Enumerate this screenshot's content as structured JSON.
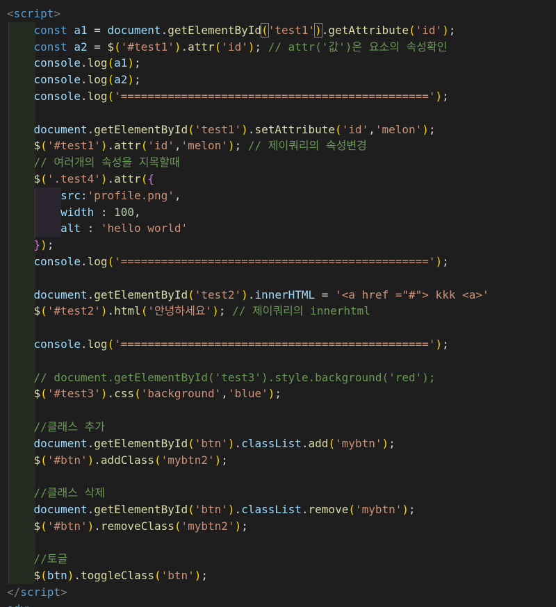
{
  "editor": {
    "lines": [
      [
        {
          "t": "<",
          "c": "tok-bracket"
        },
        {
          "t": "script",
          "c": "tok-tag"
        },
        {
          "t": ">",
          "c": "tok-bracket"
        }
      ],
      [
        {
          "t": "    const ",
          "c": "tok-kw"
        },
        {
          "t": "a1",
          "c": "tok-var"
        },
        {
          "t": " = ",
          "c": "tok-p"
        },
        {
          "t": "document",
          "c": "tok-var"
        },
        {
          "t": ".",
          "c": "tok-p"
        },
        {
          "t": "getElementById",
          "c": "tok-fn"
        },
        {
          "t": "(",
          "c": "tok-brk1 cursor-box"
        },
        {
          "t": "'test1'",
          "c": "tok-str"
        },
        {
          "t": ")",
          "c": "tok-brk1 cursor-box"
        },
        {
          "t": ".",
          "c": "tok-p"
        },
        {
          "t": "getAttribute",
          "c": "tok-fn"
        },
        {
          "t": "(",
          "c": "tok-brk1"
        },
        {
          "t": "'id'",
          "c": "tok-str"
        },
        {
          "t": ")",
          "c": "tok-brk1"
        },
        {
          "t": ";",
          "c": "tok-p"
        }
      ],
      [
        {
          "t": "    const ",
          "c": "tok-kw"
        },
        {
          "t": "a2",
          "c": "tok-var"
        },
        {
          "t": " = ",
          "c": "tok-p"
        },
        {
          "t": "$",
          "c": "tok-fn"
        },
        {
          "t": "(",
          "c": "tok-brk1"
        },
        {
          "t": "'#test1'",
          "c": "tok-str"
        },
        {
          "t": ")",
          "c": "tok-brk1"
        },
        {
          "t": ".",
          "c": "tok-p"
        },
        {
          "t": "attr",
          "c": "tok-fn"
        },
        {
          "t": "(",
          "c": "tok-brk1"
        },
        {
          "t": "'id'",
          "c": "tok-str"
        },
        {
          "t": ")",
          "c": "tok-brk1"
        },
        {
          "t": "; ",
          "c": "tok-p"
        },
        {
          "t": "// attr('값')은 요소의 속성확인",
          "c": "tok-com"
        }
      ],
      [
        {
          "t": "    console",
          "c": "tok-var"
        },
        {
          "t": ".",
          "c": "tok-p"
        },
        {
          "t": "log",
          "c": "tok-fn"
        },
        {
          "t": "(",
          "c": "tok-brk1"
        },
        {
          "t": "a1",
          "c": "tok-var"
        },
        {
          "t": ")",
          "c": "tok-brk1"
        },
        {
          "t": ";",
          "c": "tok-p"
        }
      ],
      [
        {
          "t": "    console",
          "c": "tok-var"
        },
        {
          "t": ".",
          "c": "tok-p"
        },
        {
          "t": "log",
          "c": "tok-fn"
        },
        {
          "t": "(",
          "c": "tok-brk1"
        },
        {
          "t": "a2",
          "c": "tok-var"
        },
        {
          "t": ")",
          "c": "tok-brk1"
        },
        {
          "t": ";",
          "c": "tok-p"
        }
      ],
      [
        {
          "t": "    console",
          "c": "tok-var"
        },
        {
          "t": ".",
          "c": "tok-p"
        },
        {
          "t": "log",
          "c": "tok-fn"
        },
        {
          "t": "(",
          "c": "tok-brk1"
        },
        {
          "t": "'=============================================='",
          "c": "tok-str"
        },
        {
          "t": ")",
          "c": "tok-brk1"
        },
        {
          "t": ";",
          "c": "tok-p"
        }
      ],
      [],
      [
        {
          "t": "    document",
          "c": "tok-var"
        },
        {
          "t": ".",
          "c": "tok-p"
        },
        {
          "t": "getElementById",
          "c": "tok-fn"
        },
        {
          "t": "(",
          "c": "tok-brk1"
        },
        {
          "t": "'test1'",
          "c": "tok-str"
        },
        {
          "t": ")",
          "c": "tok-brk1"
        },
        {
          "t": ".",
          "c": "tok-p"
        },
        {
          "t": "setAttribute",
          "c": "tok-fn"
        },
        {
          "t": "(",
          "c": "tok-brk1"
        },
        {
          "t": "'id'",
          "c": "tok-str"
        },
        {
          "t": ",",
          "c": "tok-p"
        },
        {
          "t": "'melon'",
          "c": "tok-str"
        },
        {
          "t": ")",
          "c": "tok-brk1"
        },
        {
          "t": ";",
          "c": "tok-p"
        }
      ],
      [
        {
          "t": "    $",
          "c": "tok-fn"
        },
        {
          "t": "(",
          "c": "tok-brk1"
        },
        {
          "t": "'#test1'",
          "c": "tok-str"
        },
        {
          "t": ")",
          "c": "tok-brk1"
        },
        {
          "t": ".",
          "c": "tok-p"
        },
        {
          "t": "attr",
          "c": "tok-fn"
        },
        {
          "t": "(",
          "c": "tok-brk1"
        },
        {
          "t": "'id'",
          "c": "tok-str"
        },
        {
          "t": ",",
          "c": "tok-p"
        },
        {
          "t": "'melon'",
          "c": "tok-str"
        },
        {
          "t": ")",
          "c": "tok-brk1"
        },
        {
          "t": "; ",
          "c": "tok-p"
        },
        {
          "t": "// 제이쿼리의 속성변경",
          "c": "tok-com"
        }
      ],
      [
        {
          "t": "    // 여러개의 속성을 지목할때",
          "c": "tok-com"
        }
      ],
      [
        {
          "t": "    $",
          "c": "tok-fn"
        },
        {
          "t": "(",
          "c": "tok-brk1"
        },
        {
          "t": "'.test4'",
          "c": "tok-str"
        },
        {
          "t": ")",
          "c": "tok-brk1"
        },
        {
          "t": ".",
          "c": "tok-p"
        },
        {
          "t": "attr",
          "c": "tok-fn"
        },
        {
          "t": "(",
          "c": "tok-brk1"
        },
        {
          "t": "{",
          "c": "tok-brk2"
        }
      ],
      [
        {
          "t": "        src",
          "c": "tok-var"
        },
        {
          "t": ":",
          "c": "tok-p"
        },
        {
          "t": "'profile.png'",
          "c": "tok-str"
        },
        {
          "t": ",",
          "c": "tok-p"
        }
      ],
      [
        {
          "t": "        width",
          "c": "tok-var"
        },
        {
          "t": " : ",
          "c": "tok-p"
        },
        {
          "t": "100",
          "c": "tok-num"
        },
        {
          "t": ",",
          "c": "tok-p"
        }
      ],
      [
        {
          "t": "        alt",
          "c": "tok-var"
        },
        {
          "t": " : ",
          "c": "tok-p"
        },
        {
          "t": "'hello world'",
          "c": "tok-str"
        }
      ],
      [
        {
          "t": "    }",
          "c": "tok-brk2"
        },
        {
          "t": ")",
          "c": "tok-brk1"
        },
        {
          "t": ";",
          "c": "tok-p"
        }
      ],
      [
        {
          "t": "    console",
          "c": "tok-var"
        },
        {
          "t": ".",
          "c": "tok-p"
        },
        {
          "t": "log",
          "c": "tok-fn"
        },
        {
          "t": "(",
          "c": "tok-brk1"
        },
        {
          "t": "'=============================================='",
          "c": "tok-str"
        },
        {
          "t": ")",
          "c": "tok-brk1"
        },
        {
          "t": ";",
          "c": "tok-p"
        }
      ],
      [],
      [
        {
          "t": "    document",
          "c": "tok-var"
        },
        {
          "t": ".",
          "c": "tok-p"
        },
        {
          "t": "getElementById",
          "c": "tok-fn"
        },
        {
          "t": "(",
          "c": "tok-brk1"
        },
        {
          "t": "'test2'",
          "c": "tok-str"
        },
        {
          "t": ")",
          "c": "tok-brk1"
        },
        {
          "t": ".",
          "c": "tok-p"
        },
        {
          "t": "innerHTML",
          "c": "tok-var"
        },
        {
          "t": " = ",
          "c": "tok-p"
        },
        {
          "t": "'<a href =\"#\"> kkk <a>'",
          "c": "tok-str"
        }
      ],
      [
        {
          "t": "    $",
          "c": "tok-fn"
        },
        {
          "t": "(",
          "c": "tok-brk1"
        },
        {
          "t": "'#test2'",
          "c": "tok-str"
        },
        {
          "t": ")",
          "c": "tok-brk1"
        },
        {
          "t": ".",
          "c": "tok-p"
        },
        {
          "t": "html",
          "c": "tok-fn"
        },
        {
          "t": "(",
          "c": "tok-brk1"
        },
        {
          "t": "'안녕하세요'",
          "c": "tok-str"
        },
        {
          "t": ")",
          "c": "tok-brk1"
        },
        {
          "t": "; ",
          "c": "tok-p"
        },
        {
          "t": "// 제이쿼리의 innerhtml",
          "c": "tok-com"
        }
      ],
      [],
      [
        {
          "t": "    console",
          "c": "tok-var"
        },
        {
          "t": ".",
          "c": "tok-p"
        },
        {
          "t": "log",
          "c": "tok-fn"
        },
        {
          "t": "(",
          "c": "tok-brk1"
        },
        {
          "t": "'=============================================='",
          "c": "tok-str"
        },
        {
          "t": ")",
          "c": "tok-brk1"
        },
        {
          "t": ";",
          "c": "tok-p"
        }
      ],
      [],
      [
        {
          "t": "    // document.getElementById('test3').style.background('red');",
          "c": "tok-com"
        }
      ],
      [
        {
          "t": "    $",
          "c": "tok-fn"
        },
        {
          "t": "(",
          "c": "tok-brk1"
        },
        {
          "t": "'#test3'",
          "c": "tok-str"
        },
        {
          "t": ")",
          "c": "tok-brk1"
        },
        {
          "t": ".",
          "c": "tok-p"
        },
        {
          "t": "css",
          "c": "tok-fn"
        },
        {
          "t": "(",
          "c": "tok-brk1"
        },
        {
          "t": "'background'",
          "c": "tok-str"
        },
        {
          "t": ",",
          "c": "tok-p"
        },
        {
          "t": "'blue'",
          "c": "tok-str"
        },
        {
          "t": ")",
          "c": "tok-brk1"
        },
        {
          "t": ";",
          "c": "tok-p"
        }
      ],
      [],
      [
        {
          "t": "    //클래스 추가",
          "c": "tok-com"
        }
      ],
      [
        {
          "t": "    document",
          "c": "tok-var"
        },
        {
          "t": ".",
          "c": "tok-p"
        },
        {
          "t": "getElementById",
          "c": "tok-fn"
        },
        {
          "t": "(",
          "c": "tok-brk1"
        },
        {
          "t": "'btn'",
          "c": "tok-str"
        },
        {
          "t": ")",
          "c": "tok-brk1"
        },
        {
          "t": ".",
          "c": "tok-p"
        },
        {
          "t": "classList",
          "c": "tok-var"
        },
        {
          "t": ".",
          "c": "tok-p"
        },
        {
          "t": "add",
          "c": "tok-fn"
        },
        {
          "t": "(",
          "c": "tok-brk1"
        },
        {
          "t": "'mybtn'",
          "c": "tok-str"
        },
        {
          "t": ")",
          "c": "tok-brk1"
        },
        {
          "t": ";",
          "c": "tok-p"
        }
      ],
      [
        {
          "t": "    $",
          "c": "tok-fn"
        },
        {
          "t": "(",
          "c": "tok-brk1"
        },
        {
          "t": "'#btn'",
          "c": "tok-str"
        },
        {
          "t": ")",
          "c": "tok-brk1"
        },
        {
          "t": ".",
          "c": "tok-p"
        },
        {
          "t": "addClass",
          "c": "tok-fn"
        },
        {
          "t": "(",
          "c": "tok-brk1"
        },
        {
          "t": "'mybtn2'",
          "c": "tok-str"
        },
        {
          "t": ")",
          "c": "tok-brk1"
        },
        {
          "t": ";",
          "c": "tok-p"
        }
      ],
      [],
      [
        {
          "t": "    //클래스 삭제",
          "c": "tok-com"
        }
      ],
      [
        {
          "t": "    document",
          "c": "tok-var"
        },
        {
          "t": ".",
          "c": "tok-p"
        },
        {
          "t": "getElementById",
          "c": "tok-fn"
        },
        {
          "t": "(",
          "c": "tok-brk1"
        },
        {
          "t": "'btn'",
          "c": "tok-str"
        },
        {
          "t": ")",
          "c": "tok-brk1"
        },
        {
          "t": ".",
          "c": "tok-p"
        },
        {
          "t": "classList",
          "c": "tok-var"
        },
        {
          "t": ".",
          "c": "tok-p"
        },
        {
          "t": "remove",
          "c": "tok-fn"
        },
        {
          "t": "(",
          "c": "tok-brk1"
        },
        {
          "t": "'mybtn'",
          "c": "tok-str"
        },
        {
          "t": ")",
          "c": "tok-brk1"
        },
        {
          "t": ";",
          "c": "tok-p"
        }
      ],
      [
        {
          "t": "    $",
          "c": "tok-fn"
        },
        {
          "t": "(",
          "c": "tok-brk1"
        },
        {
          "t": "'#btn'",
          "c": "tok-str"
        },
        {
          "t": ")",
          "c": "tok-brk1"
        },
        {
          "t": ".",
          "c": "tok-p"
        },
        {
          "t": "removeClass",
          "c": "tok-fn"
        },
        {
          "t": "(",
          "c": "tok-brk1"
        },
        {
          "t": "'mybtn2'",
          "c": "tok-str"
        },
        {
          "t": ")",
          "c": "tok-brk1"
        },
        {
          "t": ";",
          "c": "tok-p"
        }
      ],
      [],
      [
        {
          "t": "    //토글",
          "c": "tok-com"
        }
      ],
      [
        {
          "t": "    $",
          "c": "tok-fn"
        },
        {
          "t": "(",
          "c": "tok-brk1"
        },
        {
          "t": "btn",
          "c": "tok-var"
        },
        {
          "t": ")",
          "c": "tok-brk1"
        },
        {
          "t": ".",
          "c": "tok-p"
        },
        {
          "t": "toggleClass",
          "c": "tok-fn"
        },
        {
          "t": "(",
          "c": "tok-brk1"
        },
        {
          "t": "'btn'",
          "c": "tok-str"
        },
        {
          "t": ")",
          "c": "tok-brk1"
        },
        {
          "t": ";",
          "c": "tok-p"
        }
      ],
      [
        {
          "t": "</",
          "c": "tok-bracket"
        },
        {
          "t": "script",
          "c": "tok-tag"
        },
        {
          "t": ">",
          "c": "tok-bracket"
        }
      ],
      [
        {
          "t": "ody>",
          "c": "tok-tag"
        }
      ]
    ],
    "colors": {
      "background": "#1e1e1e",
      "keyword": "#569cd6",
      "function": "#dcdcaa",
      "string": "#ce9178",
      "comment": "#6a9955",
      "variable": "#9cdcfe"
    }
  }
}
